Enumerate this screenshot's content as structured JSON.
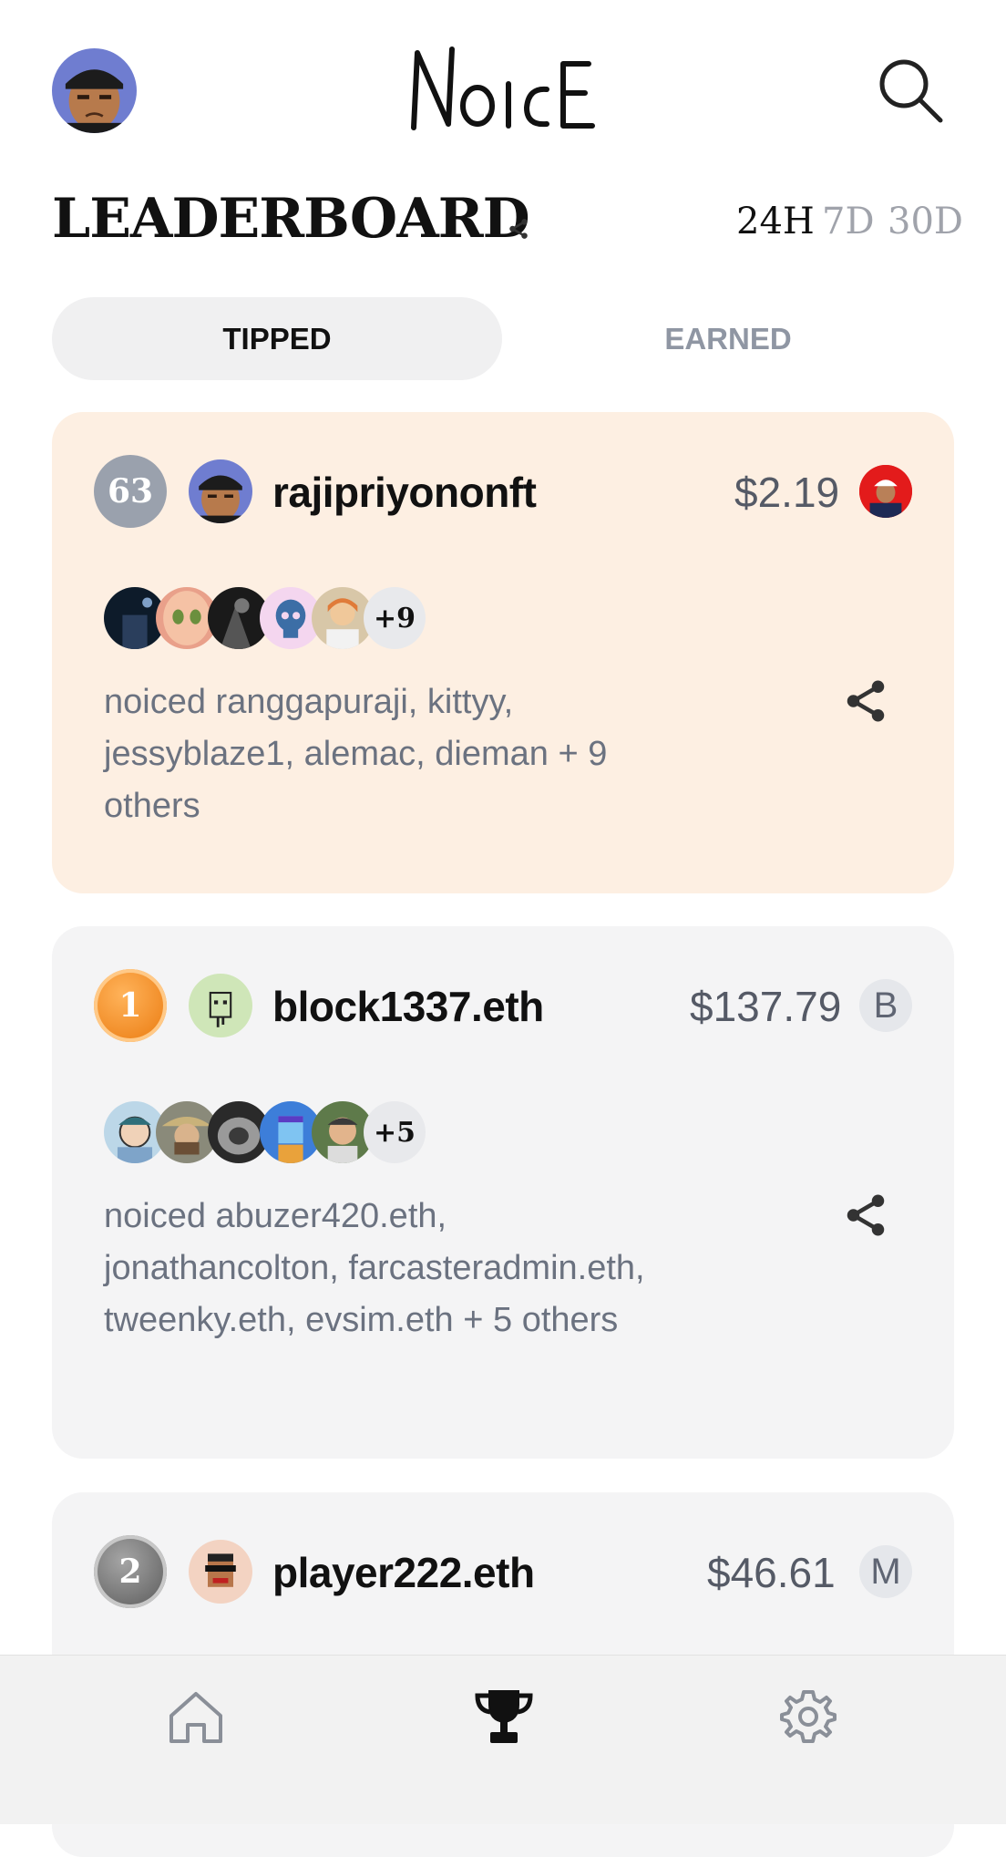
{
  "app": {
    "logo_text": "NoIcE"
  },
  "header": {
    "title": "LEADERBOARD"
  },
  "periods": [
    "24H",
    "7D",
    "30D"
  ],
  "active_period": "24H",
  "tabs": {
    "tipped": "TIPPED",
    "earned": "EARNED",
    "active": "TIPPED"
  },
  "entries": [
    {
      "rank": "63",
      "username": "rajipriyononft",
      "amount": "$2.19",
      "token": "",
      "more_count": "+9",
      "noiced_text": "noiced ranggapuraji, kittyy, jessyblaze1, alemac, dieman + 9 others"
    },
    {
      "rank": "1",
      "username": "block1337.eth",
      "amount": "$137.79",
      "token": "B",
      "more_count": "+5",
      "noiced_text": "noiced abuzer420.eth, jonathancolton, farcasteradmin.eth, tweenky.eth, evsim.eth + 5 others"
    },
    {
      "rank": "2",
      "username": "player222.eth",
      "amount": "$46.61",
      "token": "M"
    }
  ],
  "colors": {
    "highlight_card": "#fdefe2",
    "card": "#f4f4f5",
    "muted_text": "#6b7280",
    "gold": "#f08a24",
    "silver": "#7a7a7a"
  },
  "icons": {
    "search": "search-icon",
    "share": "share-icon",
    "home": "home-icon",
    "leaderboard": "trophy-icon",
    "settings": "gear-icon"
  }
}
